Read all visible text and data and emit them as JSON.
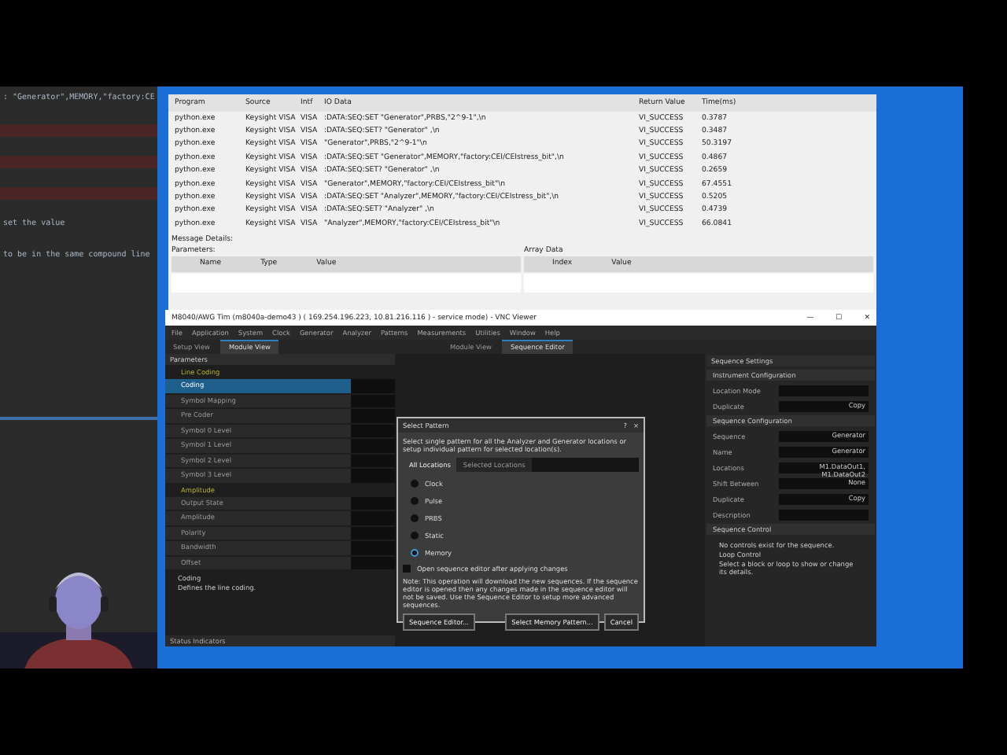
{
  "editor": {
    "lines": [
      {
        "text": ": \"Generator\",MEMORY,\"factory:CE",
        "highlighted": false
      },
      {
        "highlighted": true
      },
      {
        "highlighted": true
      },
      {
        "highlighted": true
      },
      {
        "text": "set the value",
        "highlighted": false
      },
      {
        "text": "to be in the same compound line",
        "highlighted": false
      }
    ]
  },
  "io_monitor": {
    "columns": [
      "Program",
      "Source",
      "Intf",
      "IO Data",
      "Return Value",
      "Time(ms)"
    ],
    "rows": [
      [
        "python.exe",
        "Keysight VISA",
        "VISA",
        ":DATA:SEQ:SET \"Generator\",PRBS,\"2^9-1\",\\n",
        "VI_SUCCESS",
        "0.3787"
      ],
      [
        "python.exe",
        "Keysight VISA",
        "VISA",
        ":DATA:SEQ:SET? \"Generator\" ,\\n",
        "VI_SUCCESS",
        "0.3487"
      ],
      [
        "python.exe",
        "Keysight VISA",
        "VISA",
        "\"Generator\",PRBS,\"2^9-1\"\\n",
        "VI_SUCCESS",
        "50.3197"
      ],
      [
        "python.exe",
        "Keysight VISA",
        "VISA",
        ":DATA:SEQ:SET \"Generator\",MEMORY,\"factory:CEI/CEIstress_bit\",\\n",
        "VI_SUCCESS",
        "0.4867"
      ],
      [
        "python.exe",
        "Keysight VISA",
        "VISA",
        ":DATA:SEQ:SET? \"Generator\" ,\\n",
        "VI_SUCCESS",
        "0.2659"
      ],
      [
        "python.exe",
        "Keysight VISA",
        "VISA",
        "\"Generator\",MEMORY,\"factory:CEI/CEIstress_bit\"\\n",
        "VI_SUCCESS",
        "67.4551"
      ],
      [
        "python.exe",
        "Keysight VISA",
        "VISA",
        ":DATA:SEQ:SET \"Analyzer\",MEMORY,\"factory:CEI/CEIstress_bit\",\\n",
        "VI_SUCCESS",
        "0.5205"
      ],
      [
        "python.exe",
        "Keysight VISA",
        "VISA",
        ":DATA:SEQ:SET? \"Analyzer\" ,\\n",
        "VI_SUCCESS",
        "0.4739"
      ],
      [
        "python.exe",
        "Keysight VISA",
        "VISA",
        "\"Analyzer\",MEMORY,\"factory:CEI/CEIstress_bit\"\\n",
        "VI_SUCCESS",
        "66.0841"
      ]
    ],
    "message_details": "Message Details:",
    "parameters": "Parameters:",
    "parameter_columns": [
      "Name",
      "Type",
      "Value"
    ],
    "array_data": "Array Data",
    "array_columns": [
      "Index",
      "Value"
    ]
  },
  "vnc": {
    "title": "M8040/AWG Tim (m8040a-demo43 ) ( 169.254.196.223, 10.81.216.116 ) - service mode) - VNC Viewer",
    "window_buttons": [
      "—",
      "☐",
      "✕"
    ],
    "menu": [
      "File",
      "Application",
      "System",
      "Clock",
      "Generator",
      "Analyzer",
      "Patterns",
      "Measurements",
      "Utilities",
      "Window",
      "Help"
    ],
    "left_tabs": [
      {
        "label": "Setup View",
        "selected": false
      },
      {
        "label": "Module View",
        "selected": true
      }
    ],
    "right_tabs": [
      {
        "label": "Module View",
        "selected": false
      },
      {
        "label": "Sequence Editor",
        "selected": true
      }
    ],
    "parameters_title": "Parameters",
    "groups": [
      {
        "label": "Line Coding",
        "items": [
          {
            "label": "Coding",
            "selected": true
          },
          {
            "label": "Symbol Mapping",
            "selected": false
          },
          {
            "label": "Pre Coder",
            "selected": false
          },
          {
            "label": "Symbol 0 Level",
            "selected": false
          },
          {
            "label": "Symbol 1 Level",
            "selected": false
          },
          {
            "label": "Symbol 2 Level",
            "selected": false
          },
          {
            "label": "Symbol 3 Level",
            "selected": false
          }
        ]
      },
      {
        "label": "Amplitude",
        "items": [
          {
            "label": "Output State",
            "selected": false
          },
          {
            "label": "Amplitude",
            "selected": false
          },
          {
            "label": "Polarity",
            "selected": false
          },
          {
            "label": "Bandwidth",
            "selected": false
          },
          {
            "label": "Offset",
            "selected": false
          }
        ]
      }
    ],
    "help_title": "Coding",
    "help_text": "Defines the line coding.",
    "status": "Status Indicators",
    "sequence_settings": {
      "title": "Sequence Settings",
      "sections": [
        {
          "title": "Instrument Configuration",
          "fields": [
            {
              "label": "Location Mode"
            },
            {
              "label": "Duplicate",
              "value": "Copy"
            }
          ]
        },
        {
          "title": "Sequence Configuration",
          "fields": [
            {
              "label": "Sequence",
              "value": "Generator"
            },
            {
              "label": "Name",
              "value": "Generator"
            },
            {
              "label": "Locations",
              "value": "M1.DataOut1, M1.DataOut2"
            },
            {
              "label": "Shift Between",
              "value": "None"
            },
            {
              "label": "Duplicate",
              "value": "Copy"
            },
            {
              "label": "Description"
            }
          ]
        }
      ],
      "control_title": "Sequence Control",
      "control_text": "No controls exist for the sequence.",
      "loop_title": "Loop Control",
      "loop_text": "Select a block or loop to show or change its details."
    }
  },
  "dialog": {
    "title": "Select Pattern",
    "help": "?",
    "close": "×",
    "text": "Select single pattern for all the Analyzer and Generator locations or setup individual pattern for selected location(s).",
    "tabs": [
      {
        "label": "All Locations",
        "selected": true
      },
      {
        "label": "Selected Locations",
        "selected": false
      }
    ],
    "options": [
      {
        "label": "Clock",
        "selected": false
      },
      {
        "label": "Pulse",
        "selected": false
      },
      {
        "label": "PRBS",
        "selected": false
      },
      {
        "label": "Static",
        "selected": false
      },
      {
        "label": "Memory",
        "selected": true
      }
    ],
    "open_editor": {
      "label": "Open sequence editor after applying changes",
      "checked": false
    },
    "note": "Note: This operation will download the new sequences. If the sequence editor is opened then any changes made in the sequence editor will not be saved. Use the Sequence Editor to setup more advanced sequences.",
    "buttons": [
      "Sequence Editor...",
      "Select Memory Pattern...",
      "Cancel"
    ]
  }
}
